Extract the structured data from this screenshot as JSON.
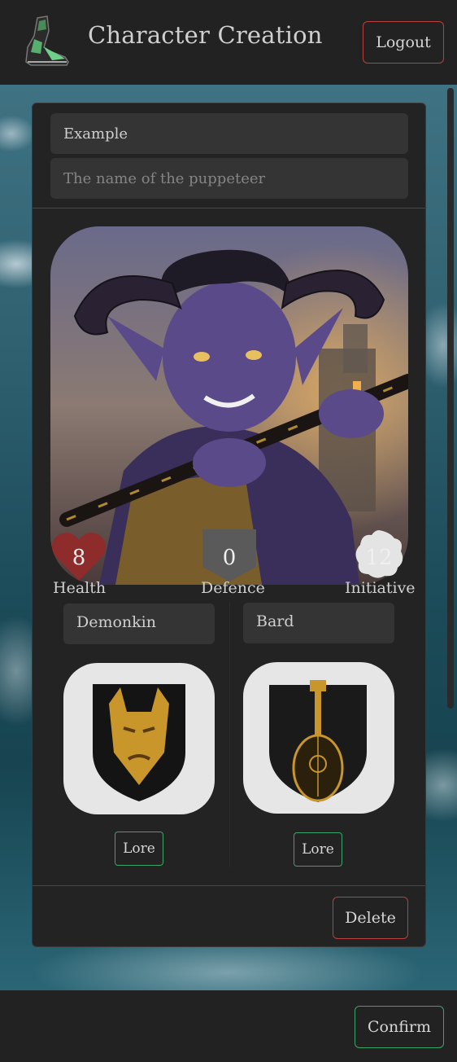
{
  "header": {
    "title": "Character Creation",
    "logout_label": "Logout"
  },
  "character": {
    "name_value": "Example",
    "description_placeholder": "The name of the puppeteer"
  },
  "stats": {
    "health": {
      "value": "8",
      "label": "Health",
      "color": "#8e2b2b"
    },
    "defence": {
      "value": "0",
      "label": "Defence",
      "color": "#5a5a5a"
    },
    "initiative": {
      "value": "12",
      "label": "Initiative",
      "color": "#e4e4e4"
    }
  },
  "race": {
    "selected": "Demonkin",
    "lore_label": "Lore",
    "emblem_icon": "demon-mask-shield-icon"
  },
  "class": {
    "selected": "Bard",
    "lore_label": "Lore",
    "emblem_icon": "lute-shield-icon"
  },
  "actions": {
    "delete_label": "Delete",
    "confirm_label": "Confirm"
  },
  "colors": {
    "accent_green": "#3da36a",
    "accent_red": "#b8413f",
    "panel": "#232323"
  }
}
